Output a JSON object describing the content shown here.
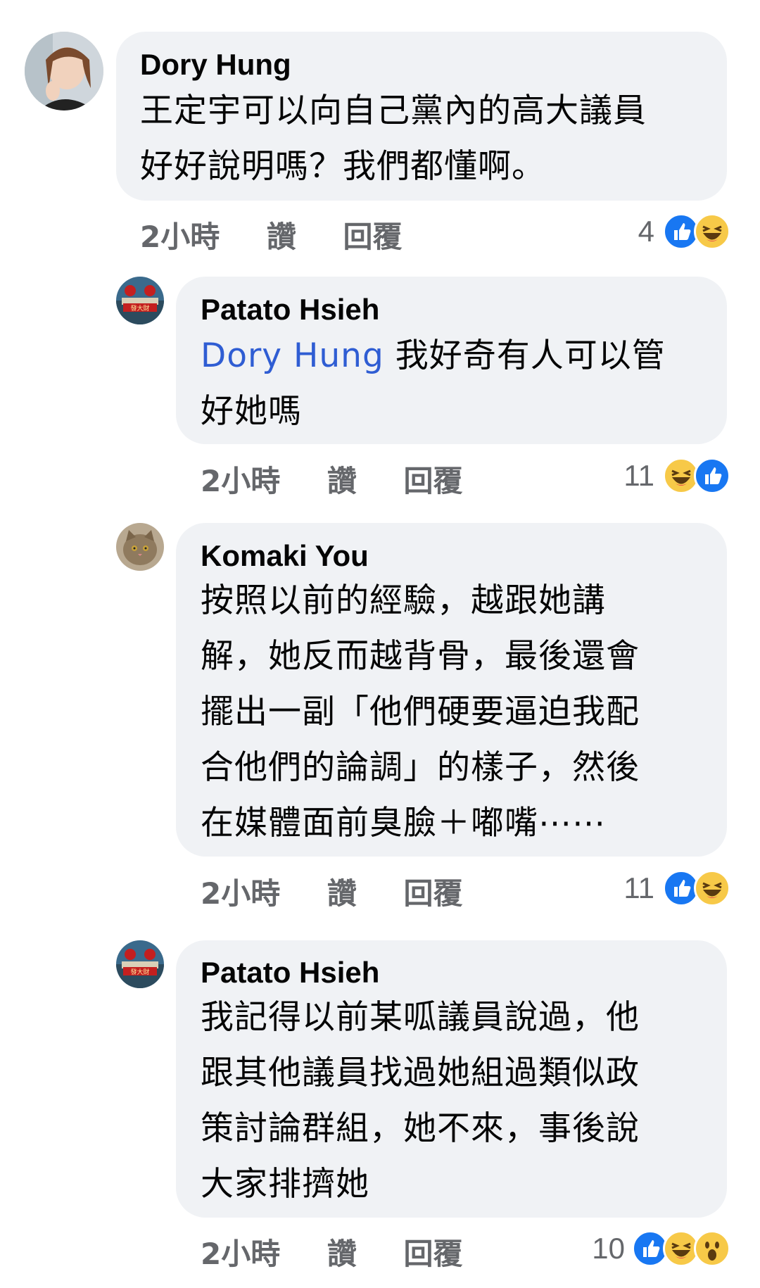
{
  "comments": [
    {
      "author": "Dory Hung",
      "mention": "",
      "text_lines": [
        "王定宇可以向自己黨內的高大議員",
        "好好說明嗎？我們都懂啊。"
      ],
      "time": "2小時",
      "like_label": "讚",
      "reply_label": "回覆",
      "reaction_count": "4",
      "reactions": [
        "like-icon",
        "haha-icon"
      ]
    },
    {
      "author": "Patato Hsieh",
      "mention": "Dory Hung",
      "text_lines": [
        " 我好奇有人可以管",
        "好她嗎"
      ],
      "time": "2小時",
      "like_label": "讚",
      "reply_label": "回覆",
      "reaction_count": "11",
      "reactions": [
        "haha-icon",
        "like-icon"
      ]
    },
    {
      "author": "Komaki You",
      "mention": "",
      "text_lines": [
        "按照以前的經驗，越跟她講",
        "解，她反而越背骨，最後還會",
        "擺出一副「他們硬要逼迫我配",
        "合他們的論調」的樣子，然後",
        "在媒體面前臭臉＋嘟嘴⋯⋯"
      ],
      "time": "2小時",
      "like_label": "讚",
      "reply_label": "回覆",
      "reaction_count": "11",
      "reactions": [
        "like-icon",
        "haha-icon"
      ]
    },
    {
      "author": "Patato Hsieh",
      "mention": "",
      "text_lines": [
        "我記得以前某呱議員說過，他",
        "跟其他議員找過她組過類似政",
        "策討論群組，她不來，事後說",
        "大家排擠她"
      ],
      "time": "2小時",
      "like_label": "讚",
      "reply_label": "回覆",
      "reaction_count": "10",
      "reactions": [
        "like-icon",
        "haha-icon",
        "wow-icon"
      ]
    }
  ],
  "avatar_text": "發大財",
  "colors": {
    "bubble": "#f0f2f5",
    "meta": "#65676b",
    "mention": "#2f5dd3",
    "like": "#1877f2",
    "haha": "#f7c948"
  }
}
